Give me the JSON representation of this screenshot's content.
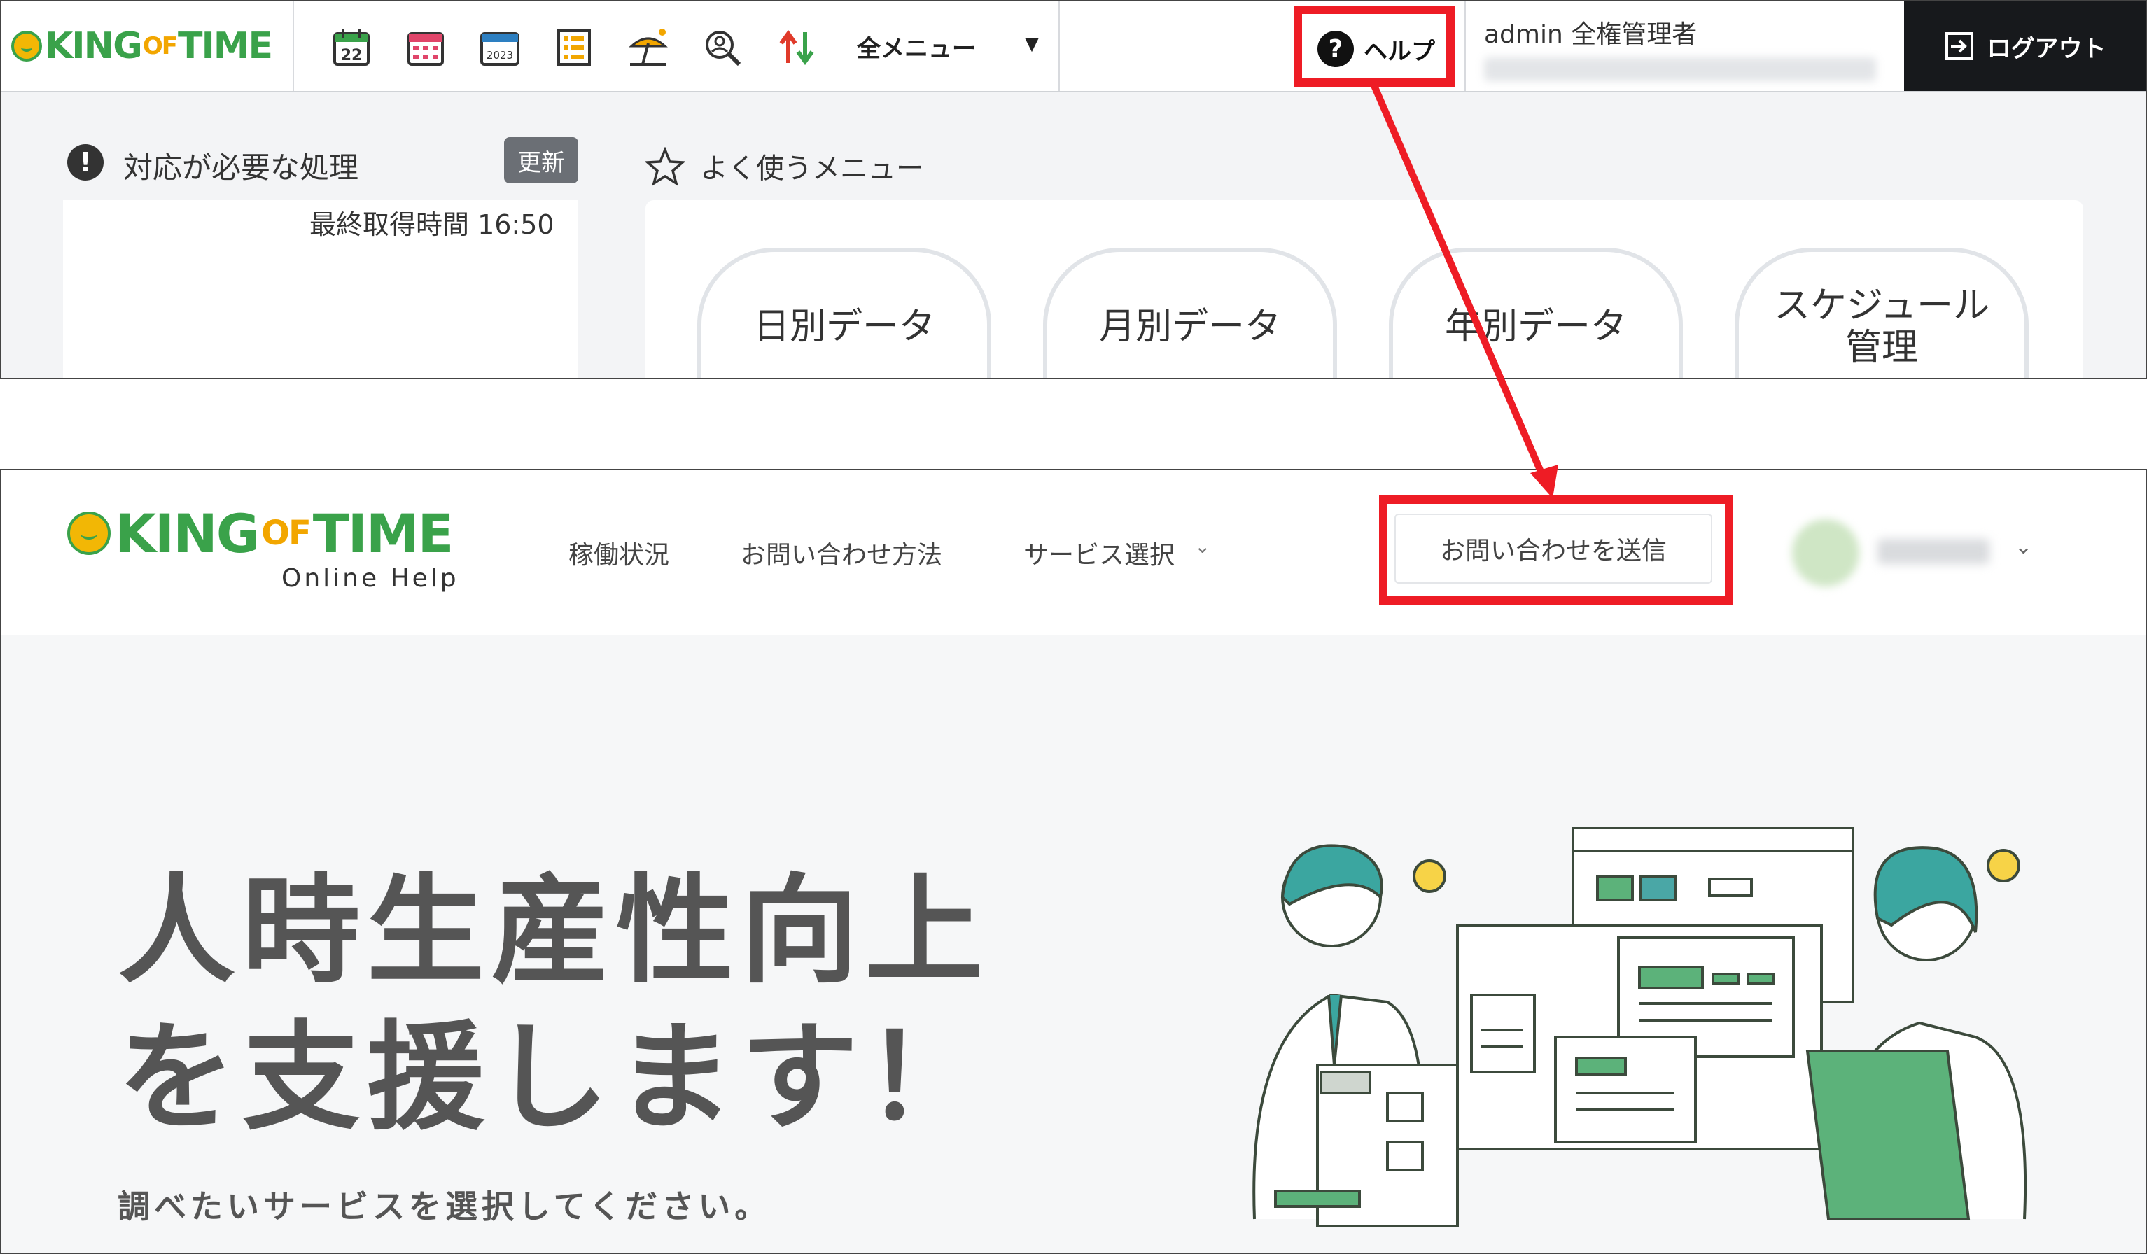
{
  "top_app": {
    "logo": {
      "king": "KING",
      "of": "OF",
      "time": "TIME"
    },
    "toolbar_icons": [
      {
        "name": "daily-calendar-icon",
        "label": "22"
      },
      {
        "name": "monthly-calendar-icon",
        "label": ""
      },
      {
        "name": "yearly-calendar-icon",
        "label": "2023"
      },
      {
        "name": "schedule-list-icon",
        "label": ""
      },
      {
        "name": "vacation-icon",
        "label": ""
      },
      {
        "name": "search-person-icon",
        "label": ""
      },
      {
        "name": "import-export-icon",
        "label": ""
      }
    ],
    "all_menu_label": "全メニュー",
    "help_label": "ヘルプ",
    "help_symbol": "?",
    "admin_label": "admin 全権管理者",
    "logout_label": "ログアウト",
    "required_actions": {
      "title": "対応が必要な処理",
      "refresh_label": "更新",
      "last_fetch": "最終取得時間 16:50"
    },
    "favorites": {
      "title": "よく使うメニュー",
      "items": [
        {
          "label": "日別データ"
        },
        {
          "label": "月別データ"
        },
        {
          "label": "年別データ"
        },
        {
          "label": "スケジュール\n管理"
        }
      ]
    }
  },
  "help_site": {
    "logo": {
      "king": "KING",
      "of": "OF",
      "time": "TIME",
      "subtitle": "Online Help"
    },
    "nav": [
      {
        "label": "稼働状況"
      },
      {
        "label": "お問い合わせ方法"
      },
      {
        "label": "サービス選択"
      }
    ],
    "contact_button_label": "お問い合わせを送信",
    "hero": {
      "line1": "人時生産性向上",
      "line2": "を支援します！",
      "subtitle": "調べたいサービスを選択してください。"
    }
  },
  "colors": {
    "highlight": "#ee1c25",
    "brand_green": "#3aa24a",
    "logout_bg": "#17191c"
  }
}
